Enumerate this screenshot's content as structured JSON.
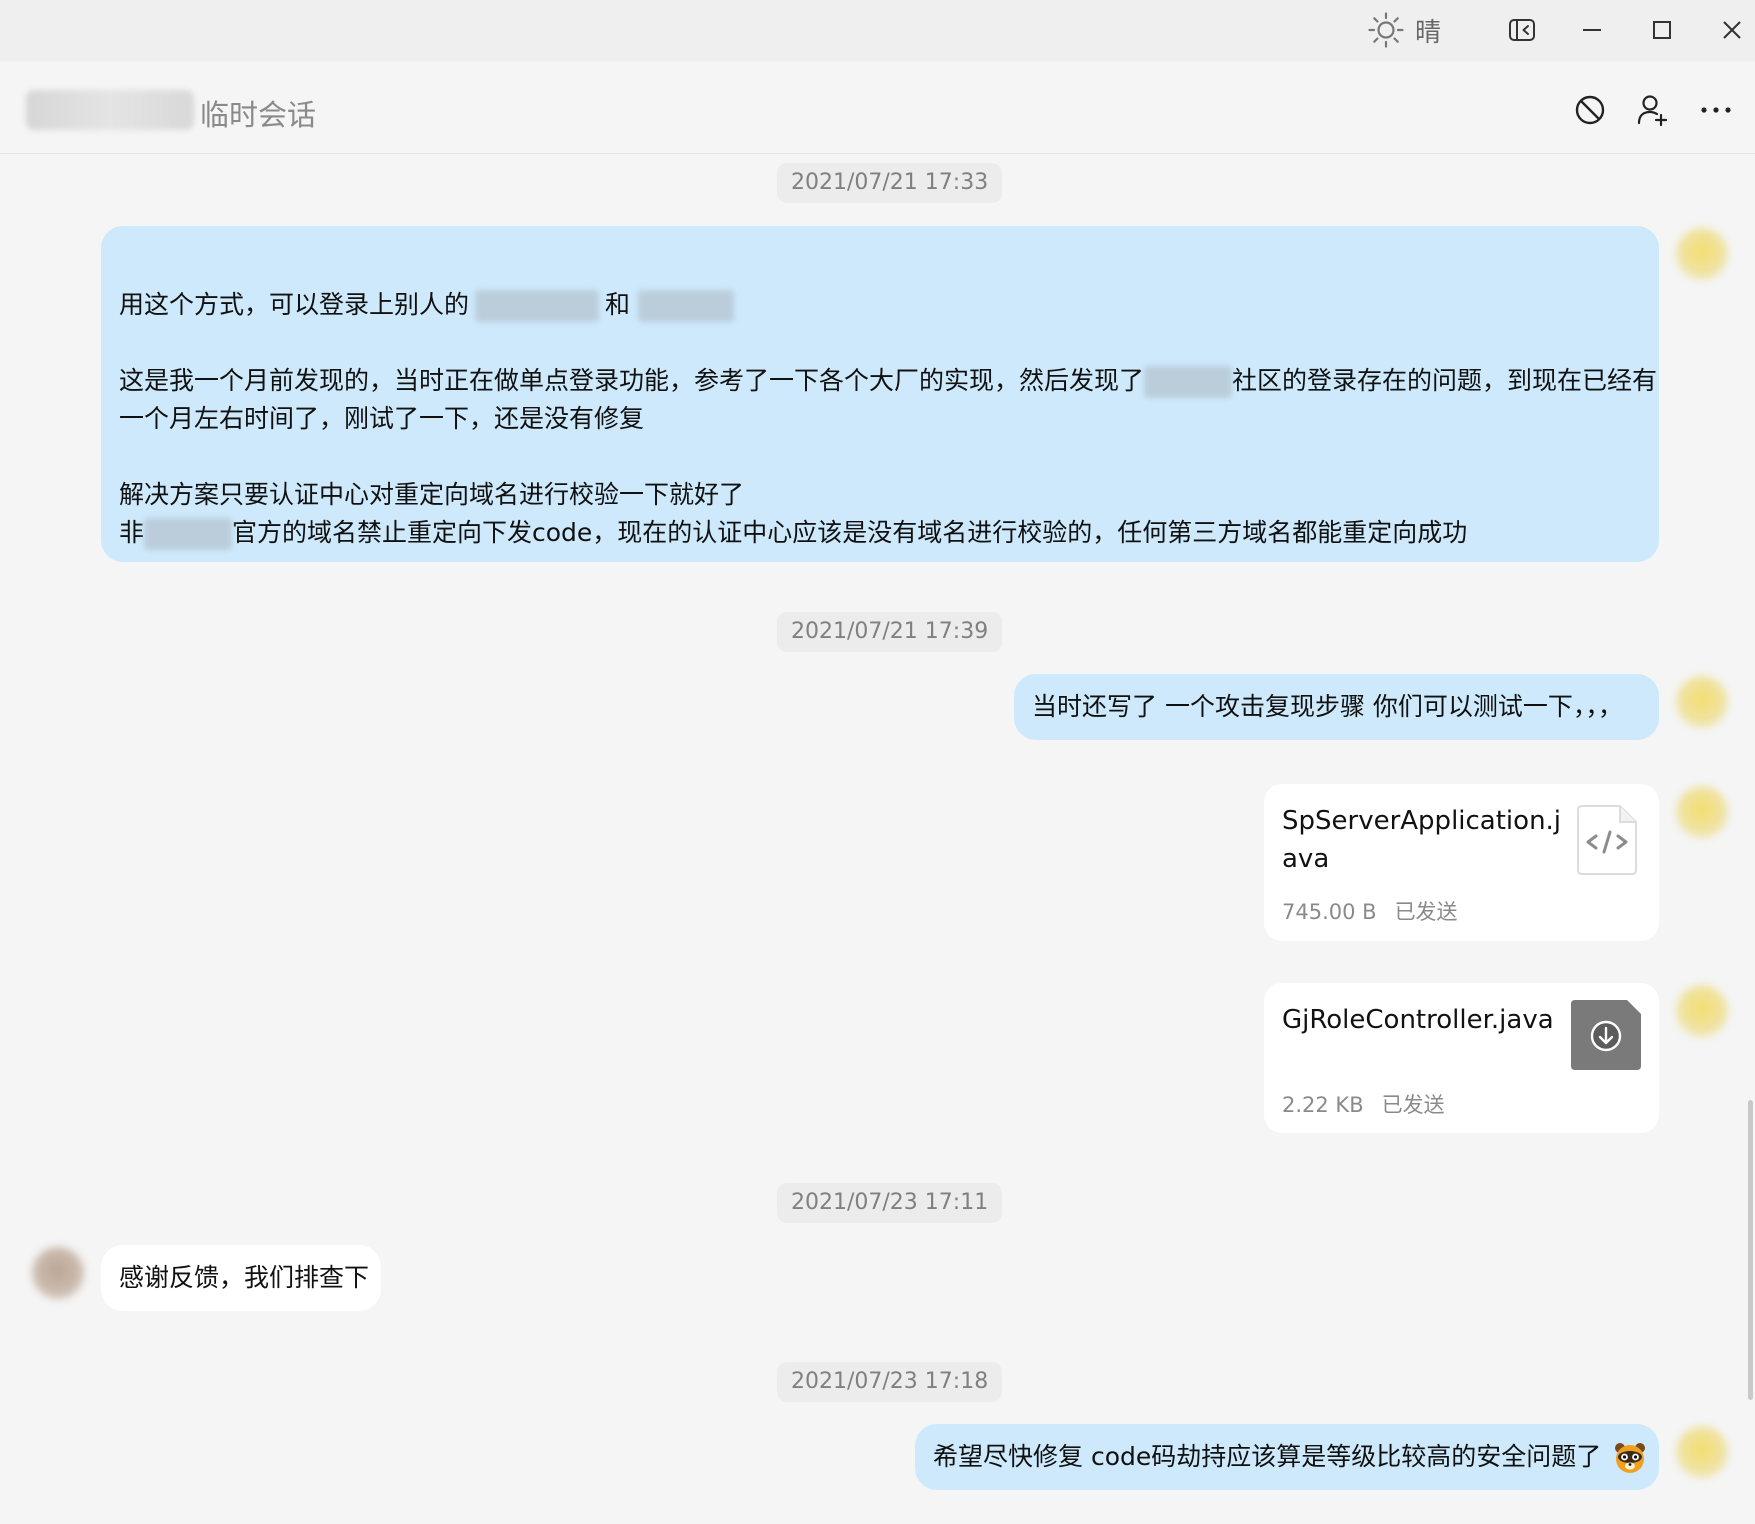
{
  "titlebar": {
    "weather_icon": "sun-icon",
    "weather_text": "晴",
    "buttons": [
      "sidebar-toggle-icon",
      "minimize-icon",
      "maximize-icon",
      "close-icon"
    ]
  },
  "header": {
    "contact_name": "",
    "subtitle": "临时会话",
    "actions": [
      "block-icon",
      "add-friend-icon",
      "more-icon"
    ]
  },
  "messages": [
    {
      "timestamp": "2021/07/21 17:33",
      "sender": "me",
      "type": "text",
      "lines": [
        "",
        "用这个方式，可以登录上别人的",
        "和",
        "这是我一个月前发现的，当时正在做单点登录功能，参考了一下各个大厂的实现，然后发现了",
        "社区的登录存在的问题，到现在已经有",
        "一个月左右时间了，刚试了一下，还是没有修复",
        "解决方案只要认证中心对重定向域名进行校验一下就好了",
        "非",
        "官方的域名禁止重定向下发code，现在的认证中心应该是没有域名进行校验的，任何第三方域名都能重定向成功"
      ]
    },
    {
      "timestamp": "2021/07/21 17:39",
      "sender": "me",
      "type": "text",
      "text": "当时还写了 一个攻击复现步骤  你们可以测试一下，，，"
    },
    {
      "sender": "me",
      "type": "file",
      "file_name": "SpServerApplication.java",
      "size": "745.00 B",
      "status": "已发送",
      "icon": "code-file-icon"
    },
    {
      "sender": "me",
      "type": "file",
      "file_name": "GjRoleController.java",
      "size": "2.22 KB",
      "status": "已发送",
      "icon": "download-icon"
    },
    {
      "timestamp": "2021/07/23 17:11",
      "sender": "other",
      "type": "text",
      "text": "感谢反馈，我们排查下"
    },
    {
      "timestamp": "2021/07/23 17:18",
      "sender": "me",
      "type": "text",
      "text": "希望尽快修复  code码劫持应该算是等级比较高的安全问题了",
      "emoji": "raccoon-emoji-icon"
    }
  ]
}
